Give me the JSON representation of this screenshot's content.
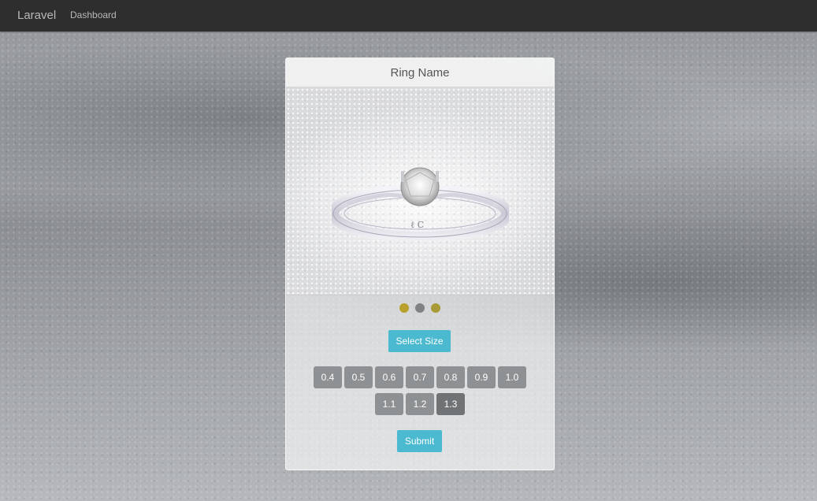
{
  "navbar": {
    "brand": "Laravel",
    "links": [
      "Dashboard"
    ]
  },
  "product": {
    "title": "Ring Name",
    "image_icon": "ring-image",
    "color_options": [
      {
        "name": "gold",
        "color": "#b8a02c"
      },
      {
        "name": "silver",
        "color": "#808286"
      },
      {
        "name": "rose-gold",
        "color": "#a89a36"
      }
    ],
    "select_size_label": "Select Size",
    "sizes_row1": [
      "0.4",
      "0.5",
      "0.6",
      "0.7",
      "0.8",
      "0.9",
      "1.0"
    ],
    "sizes_row2": [
      "1.1",
      "1.2",
      "1.3"
    ],
    "selected_size": "1.3",
    "submit_label": "Submit"
  },
  "colors": {
    "navbar_bg": "#2e2e2e",
    "accent": "#4bb9cf",
    "size_button": "#8e9194",
    "size_button_active": "#707376"
  }
}
